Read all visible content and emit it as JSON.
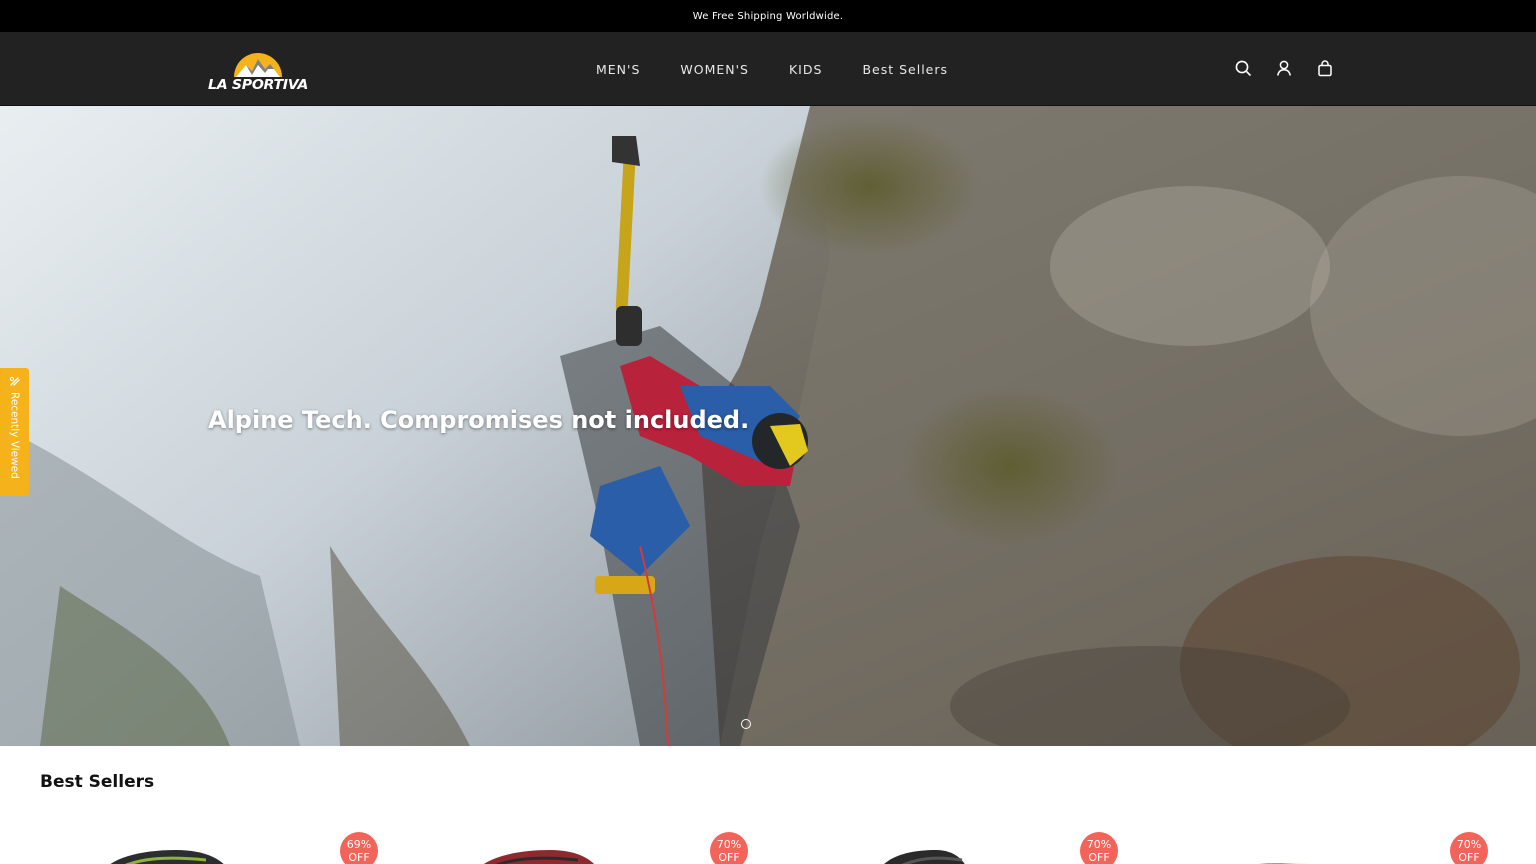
{
  "announcement": {
    "text": "We Free Shipping Worldwide."
  },
  "brand": {
    "logo_text": "LA SPORTIVA",
    "accent": "#f5b21b"
  },
  "nav": {
    "items": [
      {
        "label": "MEN'S"
      },
      {
        "label": "WOMEN'S"
      },
      {
        "label": "KIDS"
      },
      {
        "label": "Best Sellers"
      }
    ]
  },
  "header_icons": [
    "search-icon",
    "account-icon",
    "cart-icon"
  ],
  "hero": {
    "title": "Alpine Tech. Compromises not included.",
    "slide_count": 1
  },
  "recently_viewed": {
    "label": "Recently Viewed"
  },
  "best_sellers": {
    "title": "Best Sellers",
    "products": [
      {
        "discount_pct": "69%",
        "discount_word": "OFF"
      },
      {
        "discount_pct": "70%",
        "discount_word": "OFF"
      },
      {
        "discount_pct": "70%",
        "discount_word": "OFF"
      },
      {
        "discount_pct": "70%",
        "discount_word": "OFF"
      }
    ]
  },
  "colors": {
    "announce_bg": "#000000",
    "header_bg": "#222222",
    "badge_bg": "#f2645a",
    "recent_tab_bg": "#f5b21b"
  }
}
